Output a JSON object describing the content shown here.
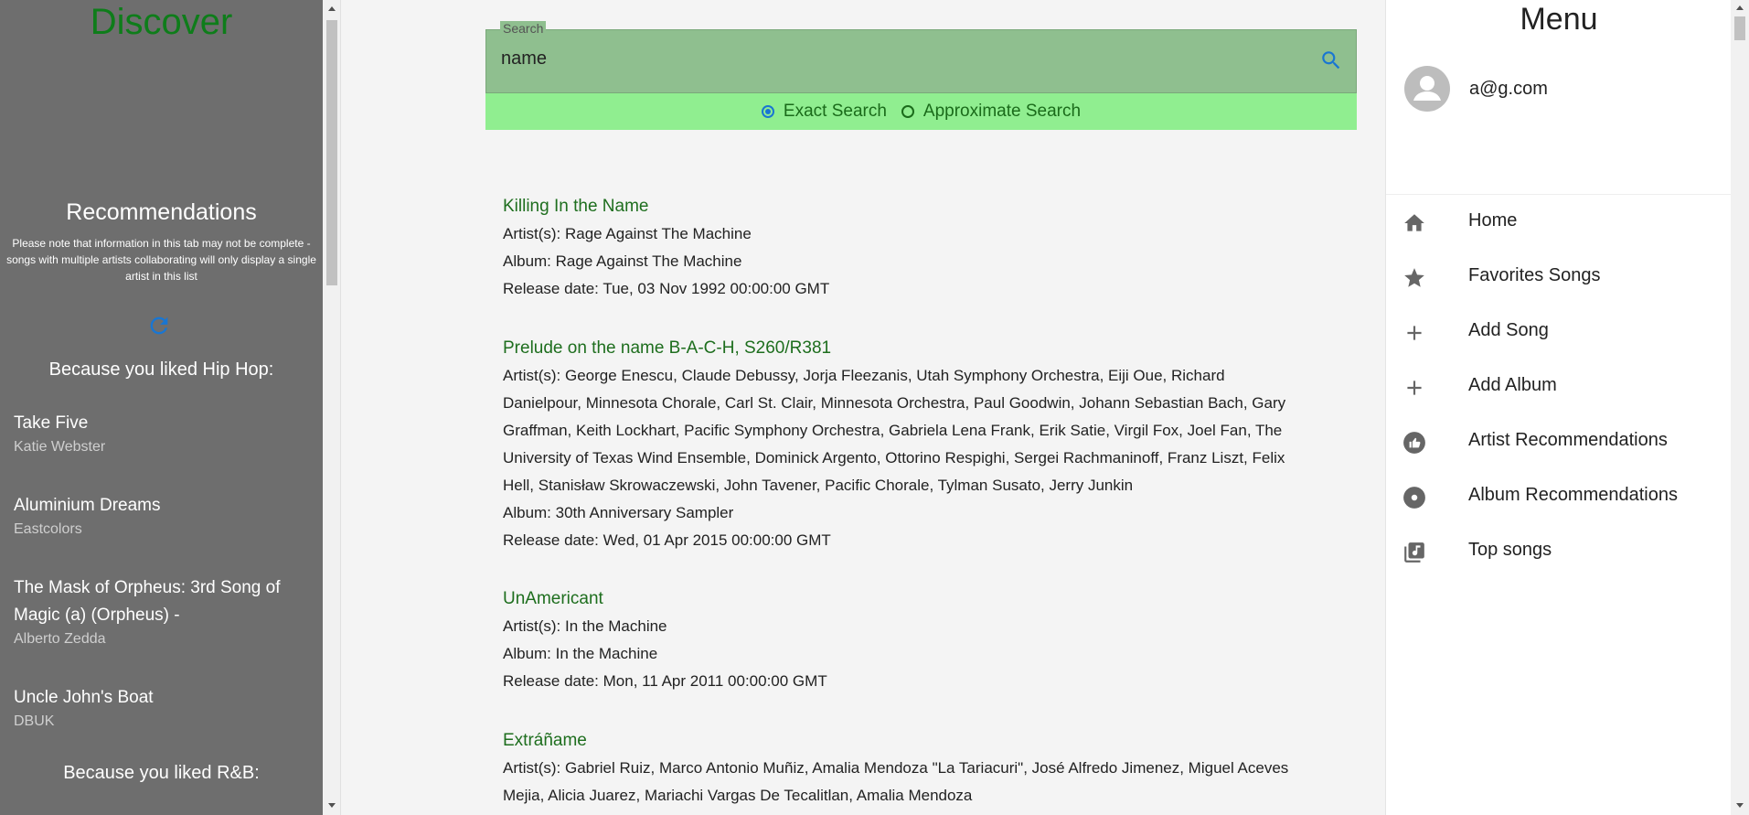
{
  "sidebar": {
    "title": "Discover",
    "recommendations_title": "Recommendations",
    "note_lines": [
      "Please note that information in this tab may not be complete -",
      "songs with multiple artists collaborating will only display a single",
      "artist in this list"
    ],
    "because_1": "Because you liked Hip Hop:",
    "songs": [
      {
        "title": "Take Five",
        "artist": "Katie Webster"
      },
      {
        "title": "Aluminium Dreams",
        "artist": "Eastcolors"
      },
      {
        "title": "The Mask of Orpheus: 3rd Song of",
        "title2": "Magic (a) (Orpheus) -",
        "artist": "Alberto Zedda"
      },
      {
        "title": "Uncle John's Boat",
        "artist": "DBUK"
      }
    ],
    "because_2": "Because you liked R&B:"
  },
  "search": {
    "legend": "Search",
    "value": "name",
    "exact_label": "Exact Search",
    "approx_label": "Approximate Search",
    "selected": "exact"
  },
  "results": [
    {
      "title": "Killing In the Name",
      "artists": "Artist(s): Rage Against The Machine",
      "album": "Album: Rage Against The Machine",
      "date": "Release date: Tue, 03 Nov 1992 00:00:00 GMT"
    },
    {
      "title": "Prelude on the name B-A-C-H, S260/R381",
      "artists_lines": [
        "Artist(s): George Enescu, Claude Debussy, Jorja Fleezanis, Utah Symphony Orchestra, Eiji Oue, Richard",
        "Danielpour, Minnesota Chorale, Carl St. Clair, Minnesota Orchestra, Paul Goodwin, Johann Sebastian Bach, Gary",
        "Graffman, Keith Lockhart, Pacific Symphony Orchestra, Gabriela Lena Frank, Erik Satie, Virgil Fox, Joel Fan, The",
        "University of Texas Wind Ensemble, Dominick Argento, Ottorino Respighi, Sergei Rachmaninoff, Franz Liszt, Felix",
        "Hell, Stanisław Skrowaczewski, John Tavener, Pacific Chorale, Tylman Susato, Jerry Junkin"
      ],
      "album": "Album: 30th Anniversary Sampler",
      "date": "Release date: Wed, 01 Apr 2015 00:00:00 GMT"
    },
    {
      "title": "UnAmericant",
      "artists": "Artist(s): In the Machine",
      "album": "Album: In the Machine",
      "date": "Release date: Mon, 11 Apr 2011 00:00:00 GMT"
    },
    {
      "title": "Extráñame",
      "artists_lines": [
        "Artist(s): Gabriel Ruiz, Marco Antonio Muñiz, Amalia Mendoza \"La Tariacuri\", José Alfredo Jimenez, Miguel Aceves",
        "Mejia, Alicia Juarez, Mariachi Vargas De Tecalitlan, Amalia Mendoza"
      ]
    }
  ],
  "menu": {
    "title": "Menu",
    "email": "a@g.com",
    "items": [
      {
        "label": "Home",
        "icon": "home-icon"
      },
      {
        "label": "Favorites Songs",
        "icon": "star-icon"
      },
      {
        "label": "Add Song",
        "icon": "plus-icon"
      },
      {
        "label": "Add Album",
        "icon": "plus-icon"
      },
      {
        "label": "Artist Recommendations",
        "icon": "thumb-up-icon"
      },
      {
        "label": "Album Recommendations",
        "icon": "disc-icon"
      },
      {
        "label": "Top songs",
        "icon": "music-library-icon"
      }
    ]
  },
  "colors": {
    "sidebar_bg": "#6e6e6e",
    "accent_green": "#0e7d1a",
    "search_bg": "#8fbf8f",
    "radio_bar_bg": "#90ee90",
    "link_blue": "#1976d2"
  }
}
